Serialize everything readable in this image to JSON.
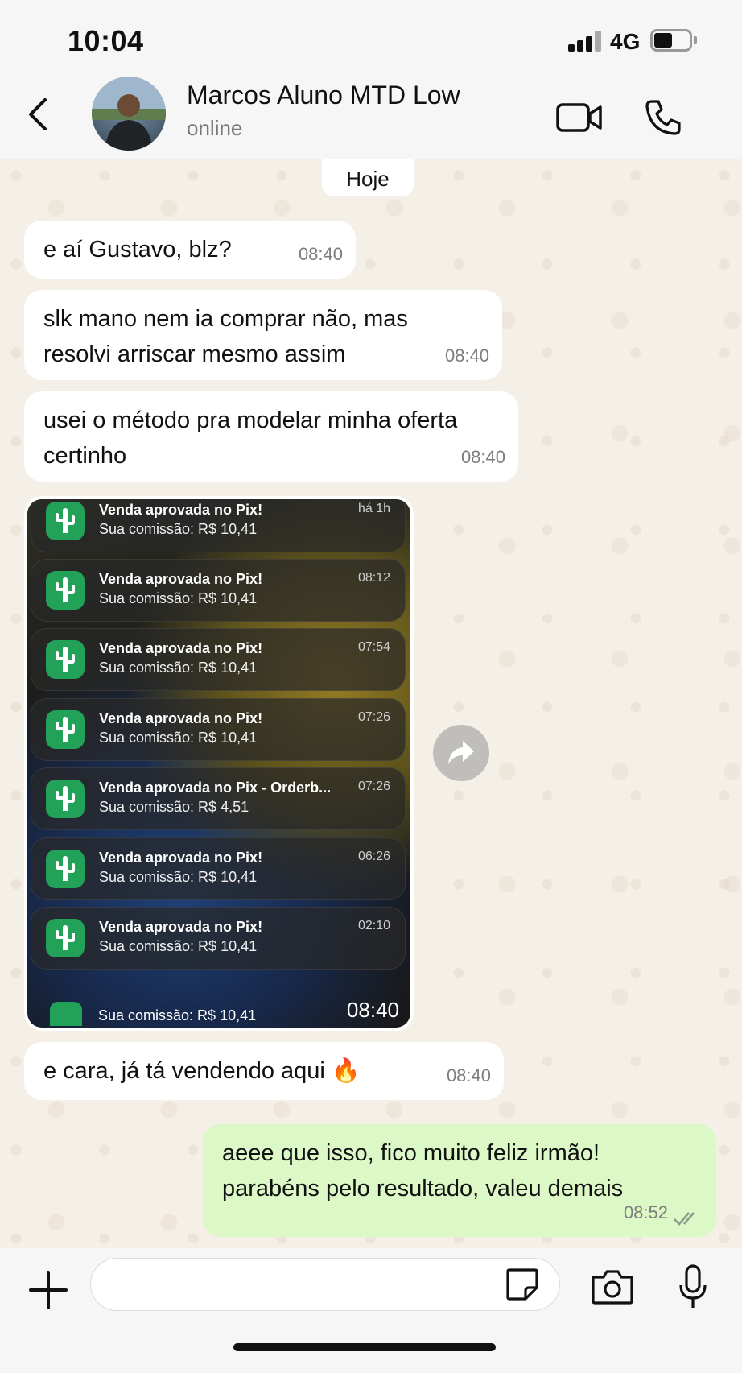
{
  "status_bar": {
    "time": "10:04",
    "network": "4G"
  },
  "header": {
    "contact_name": "Marcos Aluno MTD Low",
    "status": "online"
  },
  "date_divider": "Hoje",
  "messages": [
    {
      "text": "e aí Gustavo, blz?",
      "time": "08:40",
      "direction": "incoming"
    },
    {
      "text": "slk mano nem ia comprar não, mas resolvi arriscar mesmo assim",
      "time": "08:40",
      "direction": "incoming"
    },
    {
      "text": "usei o método pra modelar minha oferta certinho",
      "time": "08:40",
      "direction": "incoming"
    },
    {
      "text": "e cara, já tá vendendo aqui 🔥",
      "time": "08:40",
      "direction": "incoming"
    },
    {
      "text": "aeee que isso, fico muito feliz irmão! parabéns pelo resultado, valeu demais",
      "time": "08:52",
      "direction": "outgoing",
      "read": true
    }
  ],
  "image_message": {
    "time": "08:40",
    "notifications": [
      {
        "title": "Venda aprovada no Pix!",
        "body": "Sua comissão: R$ 10,41",
        "time": "há 1h"
      },
      {
        "title": "Venda aprovada no Pix!",
        "body": "Sua comissão: R$ 10,41",
        "time": "08:12"
      },
      {
        "title": "Venda aprovada no Pix!",
        "body": "Sua comissão: R$ 10,41",
        "time": "07:54"
      },
      {
        "title": "Venda aprovada no Pix!",
        "body": "Sua comissão: R$ 10,41",
        "time": "07:26"
      },
      {
        "title": "Venda aprovada no Pix - Orderb...",
        "body": "Sua comissão: R$ 4,51",
        "time": "07:26"
      },
      {
        "title": "Venda aprovada no Pix!",
        "body": "Sua comissão: R$ 10,41",
        "time": "06:26"
      },
      {
        "title": "Venda aprovada no Pix!",
        "body": "Sua comissão: R$ 10,41",
        "time": "02:10"
      }
    ],
    "partial_bottom_text": "Sua comissão: R$ 10,41"
  },
  "colors": {
    "incoming_bubble": "#ffffff",
    "outgoing_bubble": "#dcf8c6",
    "app_icon_green": "#22a259",
    "chat_bg": "#f4efe7"
  }
}
